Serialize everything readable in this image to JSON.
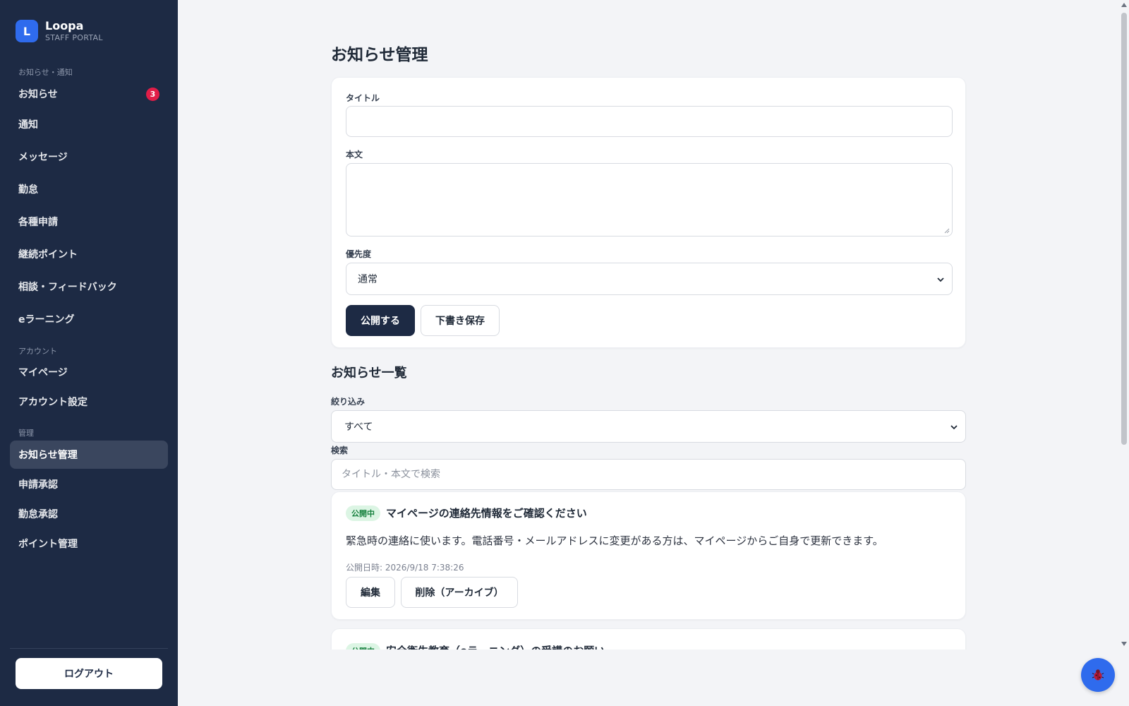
{
  "brand": {
    "logo_letter": "L",
    "name": "Loopa",
    "subtitle": "STAFF PORTAL"
  },
  "sidebar": {
    "sections": [
      {
        "label": "お知らせ・通知"
      },
      {
        "label": "アカウント"
      },
      {
        "label": "管理"
      }
    ],
    "items": [
      {
        "label": "お知らせ",
        "badge": "3"
      },
      {
        "label": "通知"
      },
      {
        "label": "メッセージ"
      },
      {
        "label": "勤怠"
      },
      {
        "label": "各種申請"
      },
      {
        "label": "継続ポイント"
      },
      {
        "label": "相談・フィードバック"
      },
      {
        "label": "eラーニング"
      },
      {
        "label": "マイページ"
      },
      {
        "label": "アカウント設定"
      },
      {
        "label": "お知らせ管理",
        "active": true
      },
      {
        "label": "申請承認"
      },
      {
        "label": "勤怠承認"
      },
      {
        "label": "ポイント管理"
      }
    ],
    "logout_label": "ログアウト"
  },
  "page": {
    "title": "お知らせ管理"
  },
  "form": {
    "title_label": "タイトル",
    "title_value": "",
    "body_label": "本文",
    "body_value": "",
    "priority_label": "優先度",
    "priority_value": "通常",
    "publish_label": "公開する",
    "draft_label": "下書き保存"
  },
  "list": {
    "title": "お知らせ一覧",
    "filter_label": "絞り込み",
    "filter_value": "すべて",
    "search_label": "検索",
    "search_placeholder": "タイトル・本文で検索",
    "notices": [
      {
        "status": "公開中",
        "title": "マイページの連絡先情報をご確認ください",
        "body": "緊急時の連絡に使います。電話番号・メールアドレスに変更がある方は、マイページからご自身で更新できます。",
        "published_at": "公開日時: 2026/9/18 7:38:26",
        "edit_label": "編集",
        "delete_label": "削除（アーカイブ）"
      },
      {
        "status": "公開中",
        "title": "安全衛生教育（eラーニング）の受講のお願い"
      }
    ]
  },
  "colors": {
    "sidebar_bg": "#1d2a44",
    "accent": "#2f6bed",
    "badge": "#e11d48",
    "status_green": "#15803d"
  },
  "icons": {
    "fab": "bug-icon",
    "select_arrow": "chevron-down-icon"
  }
}
